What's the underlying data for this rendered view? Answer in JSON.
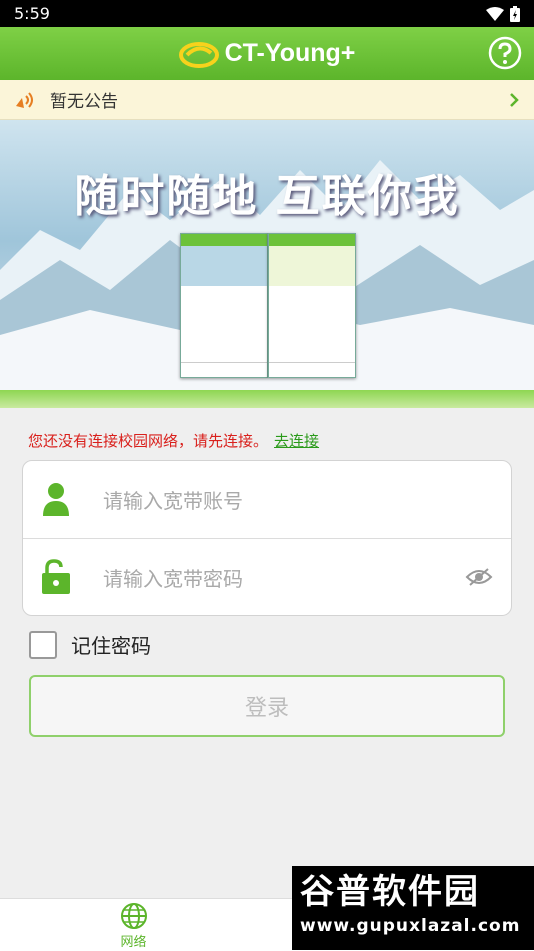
{
  "status_bar": {
    "time": "5:59"
  },
  "app_bar": {
    "title": "CT-Young+"
  },
  "notice": {
    "text": "暂无公告"
  },
  "banner": {
    "title": "随时随地  互联你我"
  },
  "form": {
    "error_text": "您还没有连接校园网络，请先连接。",
    "connect_link": "去连接",
    "account_placeholder": "请输入宽带账号",
    "password_placeholder": "请输入宽带密码",
    "remember_label": "记住密码",
    "login_label": "登录"
  },
  "tabbar": {
    "network_label": "网络"
  },
  "watermark": {
    "main": "谷普软件园",
    "url": "www.gupuxlazal.com"
  },
  "colors": {
    "brand_green": "#5cb52b",
    "error_red": "#d9201c",
    "link_green": "#2a9a1a"
  }
}
